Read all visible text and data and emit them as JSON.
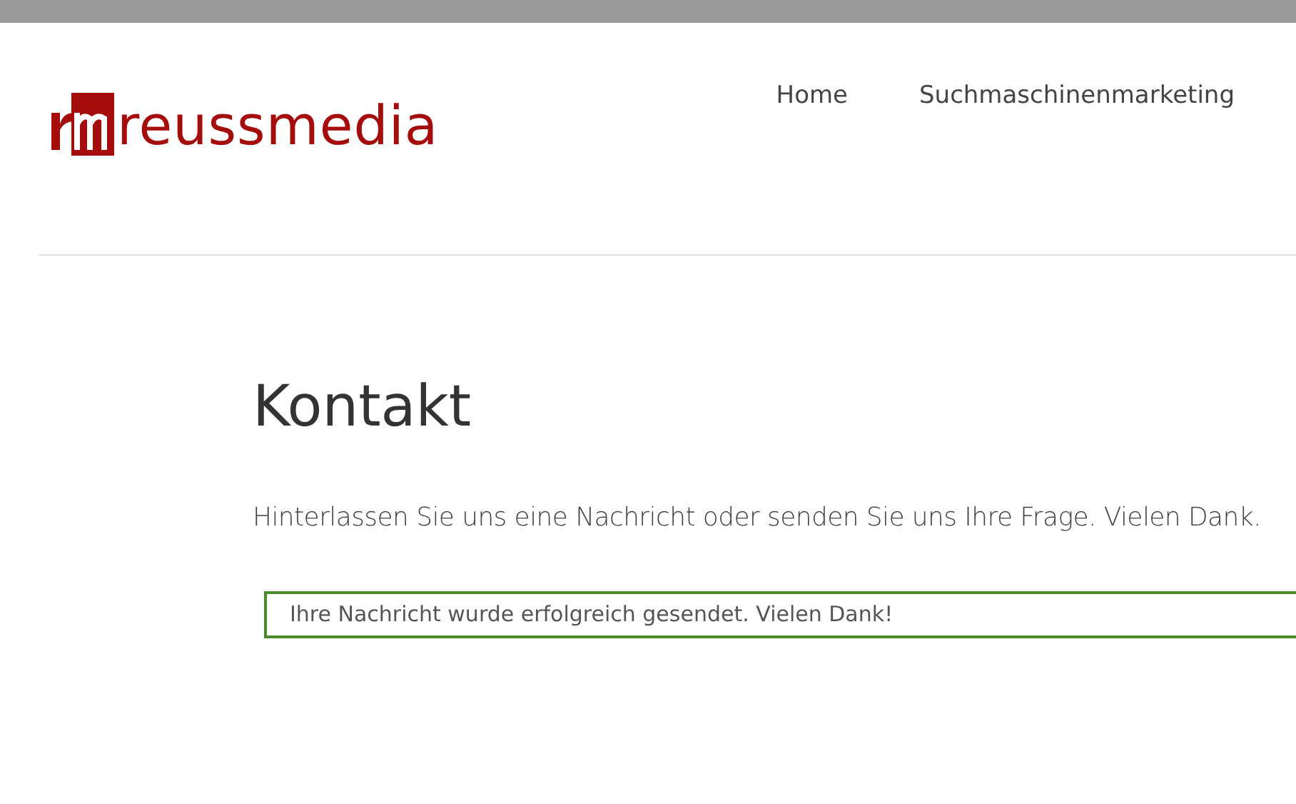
{
  "logo": {
    "text": "reussmedia"
  },
  "nav": [
    {
      "label": "Home"
    },
    {
      "label": "Suchmaschinenmarketing"
    }
  ],
  "heading": "Kontakt",
  "intro": "Hinterlassen Sie uns eine Nachricht oder senden Sie uns Ihre Frage. Vielen Dank.",
  "success_message": "Ihre Nachricht wurde erfolgreich gesendet. Vielen Dank!"
}
